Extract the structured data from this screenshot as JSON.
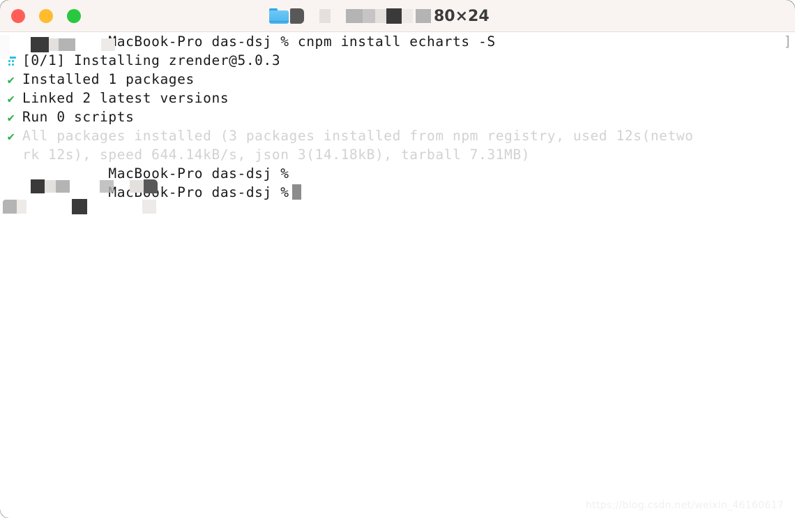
{
  "window": {
    "title_dimensions": "80×24",
    "traffic_lights": [
      {
        "name": "close",
        "color": "#ff5f57"
      },
      {
        "name": "minimize",
        "color": "#febc2e"
      },
      {
        "name": "maximize",
        "color": "#28c840"
      }
    ],
    "folder_icon_name": "folder-icon",
    "titlebar_bg": "#f9f4f1"
  },
  "terminal": {
    "bg": "#ffffff",
    "fg": "#1a1a1a",
    "dim_fg": "#d2d2d2",
    "check_color": "#2bb24c",
    "spinner_color": "#27c4de",
    "cursor_color": "#8c8c8c",
    "right_bracket": "]",
    "check_glyph": "✔",
    "lines": [
      {
        "id": "line-command",
        "gutter": "",
        "text": "          MacBook-Pro das-dsj % cnpm install echarts -S",
        "style": "normal",
        "redacted_prefix": true
      },
      {
        "id": "line-installing",
        "gutter": "spinner",
        "text": "[0/1] Installing zrender@5.0.3",
        "style": "normal"
      },
      {
        "id": "line-installed-packages",
        "gutter": "check",
        "text": "Installed 1 packages",
        "style": "normal"
      },
      {
        "id": "line-linked-versions",
        "gutter": "check",
        "text": "Linked 2 latest versions",
        "style": "normal"
      },
      {
        "id": "line-run-scripts",
        "gutter": "check",
        "text": "Run 0 scripts",
        "style": "normal"
      },
      {
        "id": "line-all-packages",
        "gutter": "check",
        "text": "All packages installed (3 packages installed from npm registry, used 12s(netwo",
        "style": "dim"
      },
      {
        "id": "line-all-packages-wrap",
        "gutter": "",
        "text": "rk 12s), speed 644.14kB/s, json 3(14.18kB), tarball 7.31MB)",
        "style": "dim"
      },
      {
        "id": "line-prompt-1",
        "gutter": "",
        "text": "          MacBook-Pro das-dsj %",
        "style": "normal",
        "redacted_prefix": true
      },
      {
        "id": "line-prompt-2",
        "gutter": "",
        "text": "          MacBook-Pro das-dsj %",
        "style": "normal",
        "redacted_prefix": true,
        "cursor": true
      }
    ]
  },
  "watermark": {
    "text": "https://blog.csdn.net/weixin_46160617"
  }
}
